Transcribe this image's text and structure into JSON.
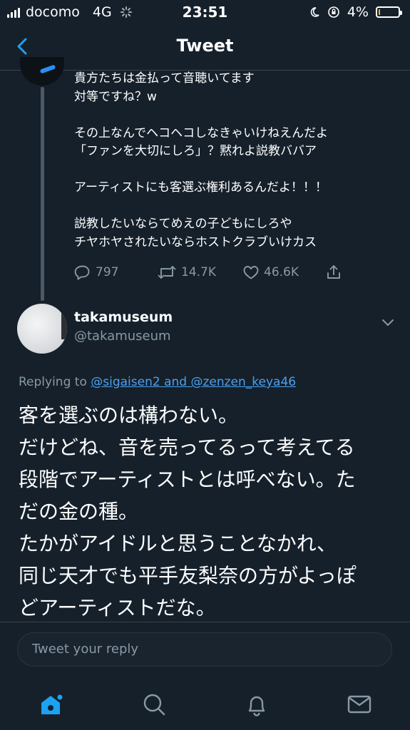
{
  "status_bar": {
    "carrier": "docomo",
    "network": "4G",
    "time": "23:51",
    "battery": "4%"
  },
  "nav": {
    "title": "Tweet",
    "back_icon": "chevron-left-icon"
  },
  "previous_tweet": {
    "lines": [
      "貴方たちは金払って音聴いてます",
      "対等ですね？w",
      "",
      "その上なんでヘコヘコしなきゃいけねえんだよ",
      "「ファンを大切にしろ」？黙れよ説教ババア",
      "",
      "アーティストにも客選ぶ権利あるんだよ！！！",
      "",
      "説教したいならてめえの子どもにしろや",
      "チヤホヤされたいならホストクラブいけカス"
    ],
    "actions": {
      "replies": "797",
      "retweets": "14.7K",
      "likes": "46.6K"
    }
  },
  "reply_tweet": {
    "author_name": "takamuseum",
    "author_handle": "@takamuseum",
    "replying_to_prefix": "Replying to ",
    "replying_to_users": "@sigaisen2 and @zenzen_keya46",
    "text_lines": [
      "客を選ぶのは構わない。",
      "だけどね、音を売ってるって考えてる",
      "段階でアーティストとは呼べない。た",
      "だの金の種。",
      "たかがアイドルと思うことなかれ、",
      "同じ天才でも平手友梨奈の方がよっぽ",
      "どアーティストだな。"
    ]
  },
  "reply_box": {
    "placeholder": "Tweet your reply"
  },
  "tab_bar": {
    "items": [
      "home-icon",
      "search-icon",
      "bell-icon",
      "mail-icon"
    ],
    "active": "home-icon"
  },
  "colors": {
    "background": "#15202b",
    "accent": "#1da1f2",
    "link": "#4ba1ef",
    "secondary_text": "#8899a6"
  }
}
